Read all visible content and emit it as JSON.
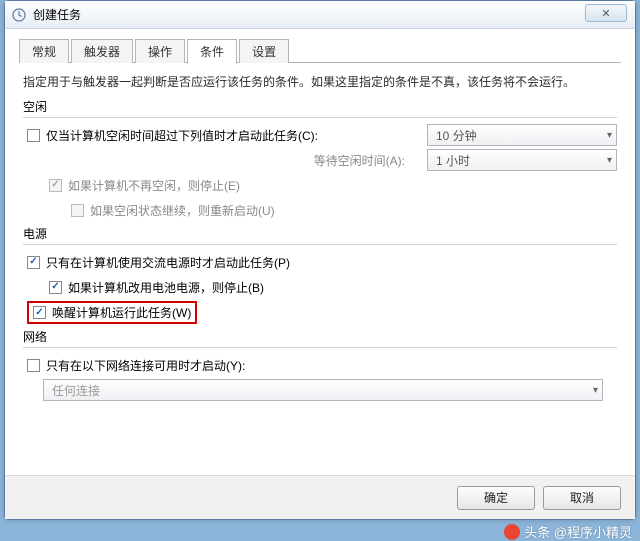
{
  "window": {
    "title": "创建任务",
    "close_glyph": "✕"
  },
  "tabs": {
    "general": "常规",
    "triggers": "触发器",
    "actions": "操作",
    "conditions": "条件",
    "settings": "设置"
  },
  "note": "指定用于与触发器一起判断是否应运行该任务的条件。如果这里指定的条件是不真，该任务将不会运行。",
  "idle": {
    "heading": "空闲",
    "only_if_idle": "仅当计算机空闲时间超过下列值时才启动此任务(C):",
    "idle_duration": "10 分钟",
    "wait_label": "等待空闲时间(A):",
    "wait_duration": "1 小时",
    "stop_if_not_idle": "如果计算机不再空闲，则停止(E)",
    "restart_if_idle": "如果空闲状态继续，则重新启动(U)"
  },
  "power": {
    "heading": "电源",
    "only_on_ac": "只有在计算机使用交流电源时才启动此任务(P)",
    "stop_on_battery": "如果计算机改用电池电源，则停止(B)",
    "wake_to_run": "唤醒计算机运行此任务(W)"
  },
  "network": {
    "heading": "网络",
    "only_if_network": "只有在以下网络连接可用时才启动(Y):",
    "any_connection": "任何连接"
  },
  "footer": {
    "ok": "确定",
    "cancel": "取消"
  },
  "watermark": "头条 @程序小精灵"
}
